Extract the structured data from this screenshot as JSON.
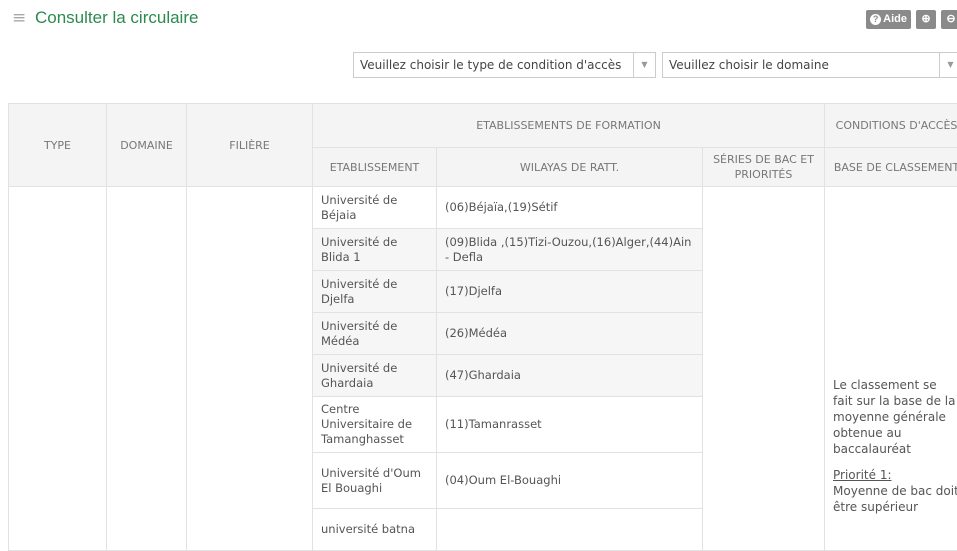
{
  "header": {
    "menu_icon": "hamburger-icon",
    "title": "Consulter la circulaire",
    "help_label": "Aide",
    "zoom_in_icon": "zoom-in-icon",
    "zoom_out_icon": "zoom-out-icon"
  },
  "filters": {
    "condition_select": "Veuillez choisir le type de condition d'accès",
    "domaine_select": "Veuillez choisir le domaine"
  },
  "table": {
    "headers": {
      "type": "TYPE",
      "domaine": "DOMAINE",
      "filiere": "FILIÈRE",
      "etablissements": "ETABLISSEMENTS DE FORMATION",
      "conditions": "CONDITIONS D'ACCÈS",
      "etablissement": "ETABLISSEMENT",
      "wilayas": "WILAYAS DE RATT.",
      "series": "SÉRIES DE BAC ET PRIORITÉS",
      "base": "BASE DE CLASSEMENT"
    },
    "rows": [
      {
        "etab": "Université de Béjaia",
        "wilayas": "(06)Béjaïa,(19)Sétif"
      },
      {
        "etab": "Université de Blida 1",
        "wilayas": "(09)Blida ,(15)Tizi-Ouzou,(16)Alger,(44)Ain - Defla"
      },
      {
        "etab": "Université de Djelfa",
        "wilayas": "(17)Djelfa"
      },
      {
        "etab": "Université de Médéa",
        "wilayas": "(26)Médéa"
      },
      {
        "etab": "Université de Ghardaia",
        "wilayas": "(47)Ghardaia"
      },
      {
        "etab": "Centre Universitaire de Tamanghasset",
        "wilayas": "(11)Tamanrasset"
      },
      {
        "etab": "Université d'Oum El Bouaghi",
        "wilayas": "(04)Oum El-Bouaghi"
      },
      {
        "etab": "université batna",
        "wilayas": ""
      }
    ],
    "base_text": "Le classement se fait sur la base de la moyenne générale obtenue au baccalauréat",
    "priority_label": "Priorité 1:",
    "priority_text": "Moyenne de bac doit être supérieur"
  }
}
